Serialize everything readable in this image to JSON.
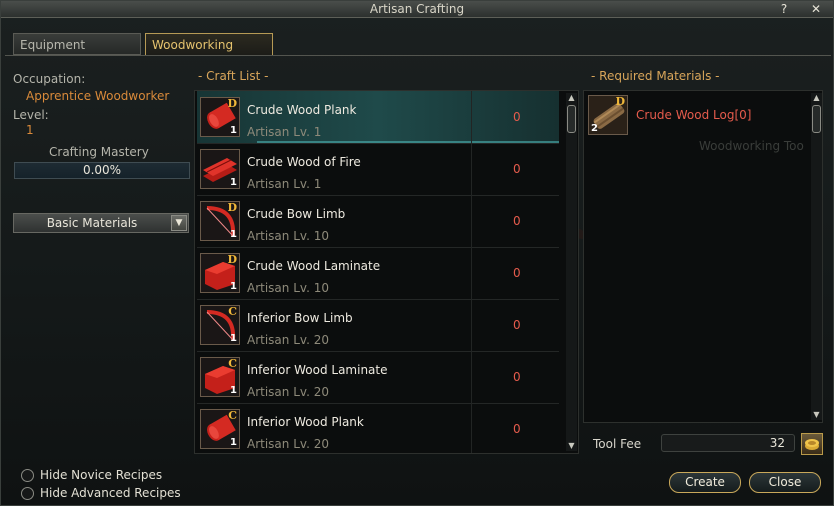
{
  "window": {
    "title": "Artisan Crafting",
    "help_label": "?",
    "close_label": "✕"
  },
  "tabs": [
    {
      "label": "Equipment",
      "active": false
    },
    {
      "label": "Woodworking",
      "active": true
    }
  ],
  "left_panel": {
    "occupation_label": "Occupation:",
    "occupation_value": "Apprentice Woodworker",
    "level_label": "Level:",
    "level_value": "1",
    "mastery_label": "Crafting Mastery",
    "mastery_value": "0.00%",
    "mastery_fraction": 0.0,
    "category_dropdown": "Basic Materials"
  },
  "craft_list": {
    "title": "- Craft List -",
    "items": [
      {
        "name": "Crude Wood Plank",
        "level": "Artisan Lv. 1",
        "count": "0",
        "grade": "D",
        "qty": "1",
        "icon": "wood-plank-icon",
        "selected": true
      },
      {
        "name": "Crude Wood of Fire",
        "level": "Artisan Lv. 1",
        "count": "0",
        "grade": "",
        "qty": "1",
        "icon": "wood-of-fire-icon",
        "selected": false
      },
      {
        "name": "Crude Bow Limb",
        "level": "Artisan Lv. 10",
        "count": "0",
        "grade": "D",
        "qty": "1",
        "icon": "bow-limb-icon",
        "selected": false
      },
      {
        "name": "Crude Wood Laminate",
        "level": "Artisan Lv. 10",
        "count": "0",
        "grade": "D",
        "qty": "1",
        "icon": "wood-laminate-icon",
        "selected": false
      },
      {
        "name": "Inferior Bow Limb",
        "level": "Artisan Lv. 20",
        "count": "0",
        "grade": "C",
        "qty": "1",
        "icon": "bow-limb-icon",
        "selected": false
      },
      {
        "name": "Inferior Wood Laminate",
        "level": "Artisan Lv. 20",
        "count": "0",
        "grade": "C",
        "qty": "1",
        "icon": "wood-laminate-icon",
        "selected": false
      },
      {
        "name": "Inferior Wood Plank",
        "level": "Artisan Lv. 20",
        "count": "0",
        "grade": "C",
        "qty": "1",
        "icon": "wood-plank-icon",
        "selected": false
      }
    ]
  },
  "required_materials": {
    "title": "- Required Materials -",
    "items": [
      {
        "name": "Crude Wood Log[0]",
        "grade": "D",
        "qty": "2",
        "icon": "wood-log-icon"
      }
    ],
    "background_text": "Woodworking Too"
  },
  "tool_fee": {
    "label": "Tool Fee",
    "value": "32"
  },
  "options": [
    {
      "label": "Hide Novice Recipes"
    },
    {
      "label": "Hide Advanced Recipes"
    }
  ],
  "buttons": {
    "create": "Create",
    "close": "Close"
  },
  "colors": {
    "accent_gold": "#d8a55a",
    "occupation_orange": "#d98a3a",
    "count_red": "#e55b4c",
    "selected_teal": "#1f4a4a"
  }
}
